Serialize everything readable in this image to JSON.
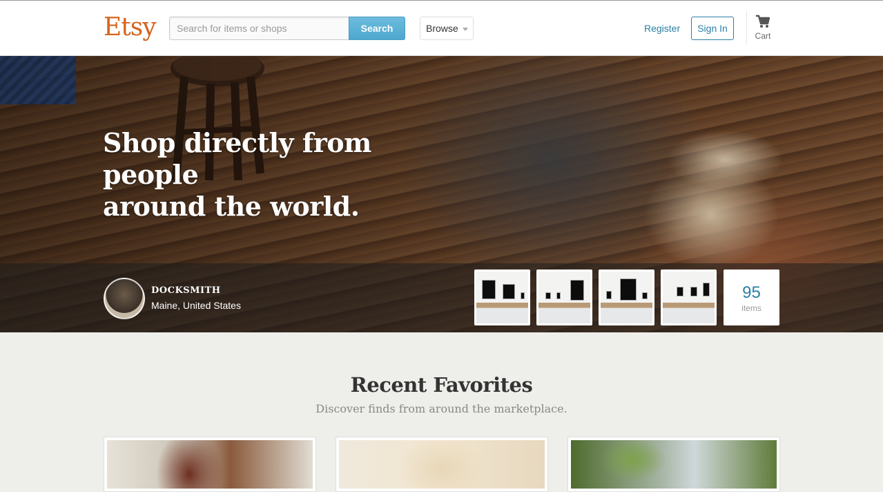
{
  "header": {
    "logo": "Etsy",
    "search": {
      "placeholder": "Search for items or shops",
      "button_label": "Search"
    },
    "browse_label": "Browse",
    "register_label": "Register",
    "signin_label": "Sign In",
    "cart_label": "Cart"
  },
  "hero": {
    "title_line1": "Shop directly from people",
    "title_line2": "around the world.",
    "shop": {
      "name": "DOCKSMITH",
      "location": "Maine, United States"
    },
    "items_count": "95",
    "items_label": "items"
  },
  "recent": {
    "title": "Recent Favorites",
    "subtitle": "Discover finds from around the marketplace."
  },
  "colors": {
    "brand": "#d5641c",
    "link": "#2a7fa5",
    "search_button": "#4ea7cf",
    "page_background": "#eeeeea"
  },
  "icons": [
    "cart-icon",
    "chevron-down-icon"
  ]
}
